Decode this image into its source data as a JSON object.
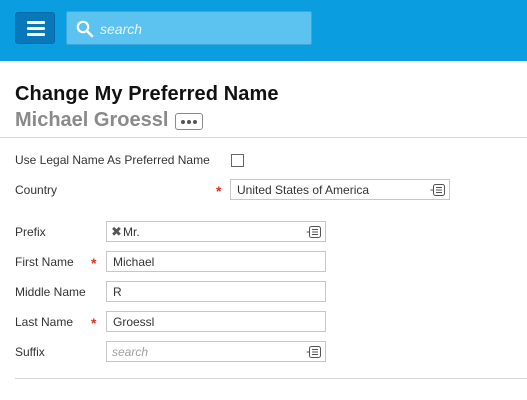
{
  "header": {
    "menu_icon": "hamburger-menu-icon",
    "search_icon": "search-icon",
    "search_placeholder": "search",
    "bar_color": "#0a9de0"
  },
  "page": {
    "title": "Change My Preferred Name",
    "subtitle": "Michael Groessl",
    "more_icon": "ellipsis-icon"
  },
  "form": {
    "use_legal_name": {
      "label": "Use Legal Name As Preferred Name",
      "checked": false
    },
    "country": {
      "label": "Country",
      "value": "United States of America",
      "required": true
    },
    "prefix": {
      "label": "Prefix",
      "value": "Mr.",
      "remove_symbol": "✖"
    },
    "first_name": {
      "label": "First Name",
      "value": "Michael",
      "required": true
    },
    "middle_name": {
      "label": "Middle Name",
      "value": "R"
    },
    "last_name": {
      "label": "Last Name",
      "value": "Groessl",
      "required": true
    },
    "suffix": {
      "label": "Suffix",
      "placeholder": "search"
    },
    "required_marker": "*",
    "required_color": "#e0301e"
  }
}
